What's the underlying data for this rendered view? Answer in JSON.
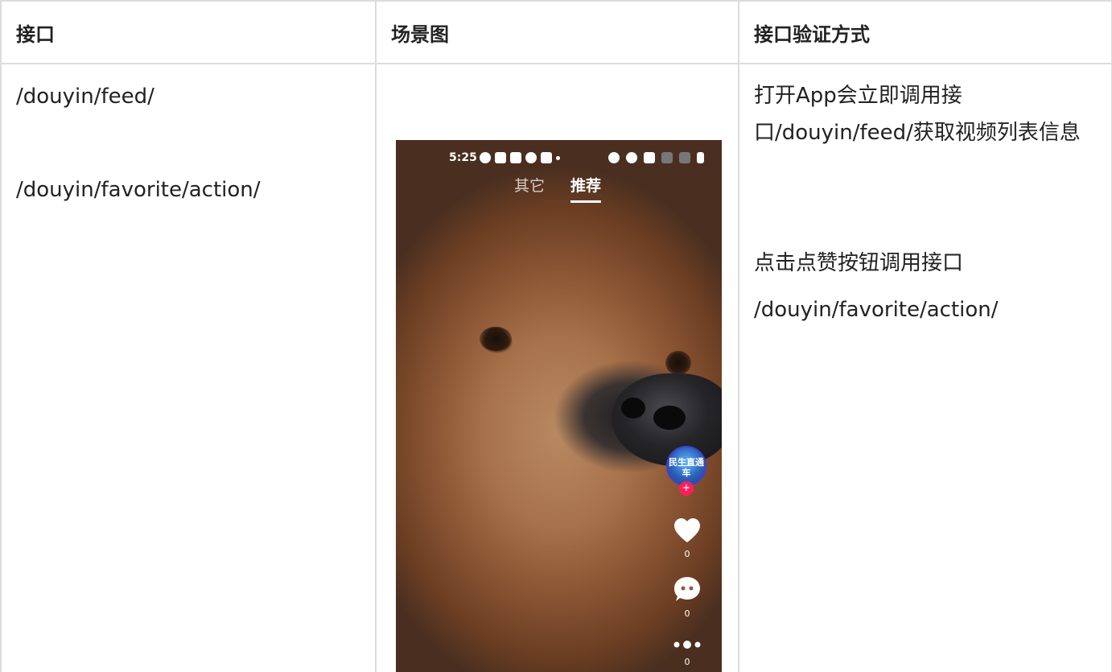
{
  "table": {
    "headers": [
      "接口",
      "场景图",
      "接口验证方式"
    ],
    "endpoints": [
      "/douyin/feed/",
      "/douyin/favorite/action/"
    ],
    "description": {
      "line1": "打开App会立即调用接口/douyin/feed/获取视频列表信息",
      "line2": "点击点赞按钮调用接口",
      "line3": "/douyin/favorite/action/"
    }
  },
  "phone": {
    "status_time": "5:25",
    "tabs": [
      "其它",
      "推荐"
    ],
    "avatar_text": "民生直通车",
    "follow_symbol": "+",
    "like_count": "0",
    "comment_count": "0",
    "share_count": "0"
  }
}
